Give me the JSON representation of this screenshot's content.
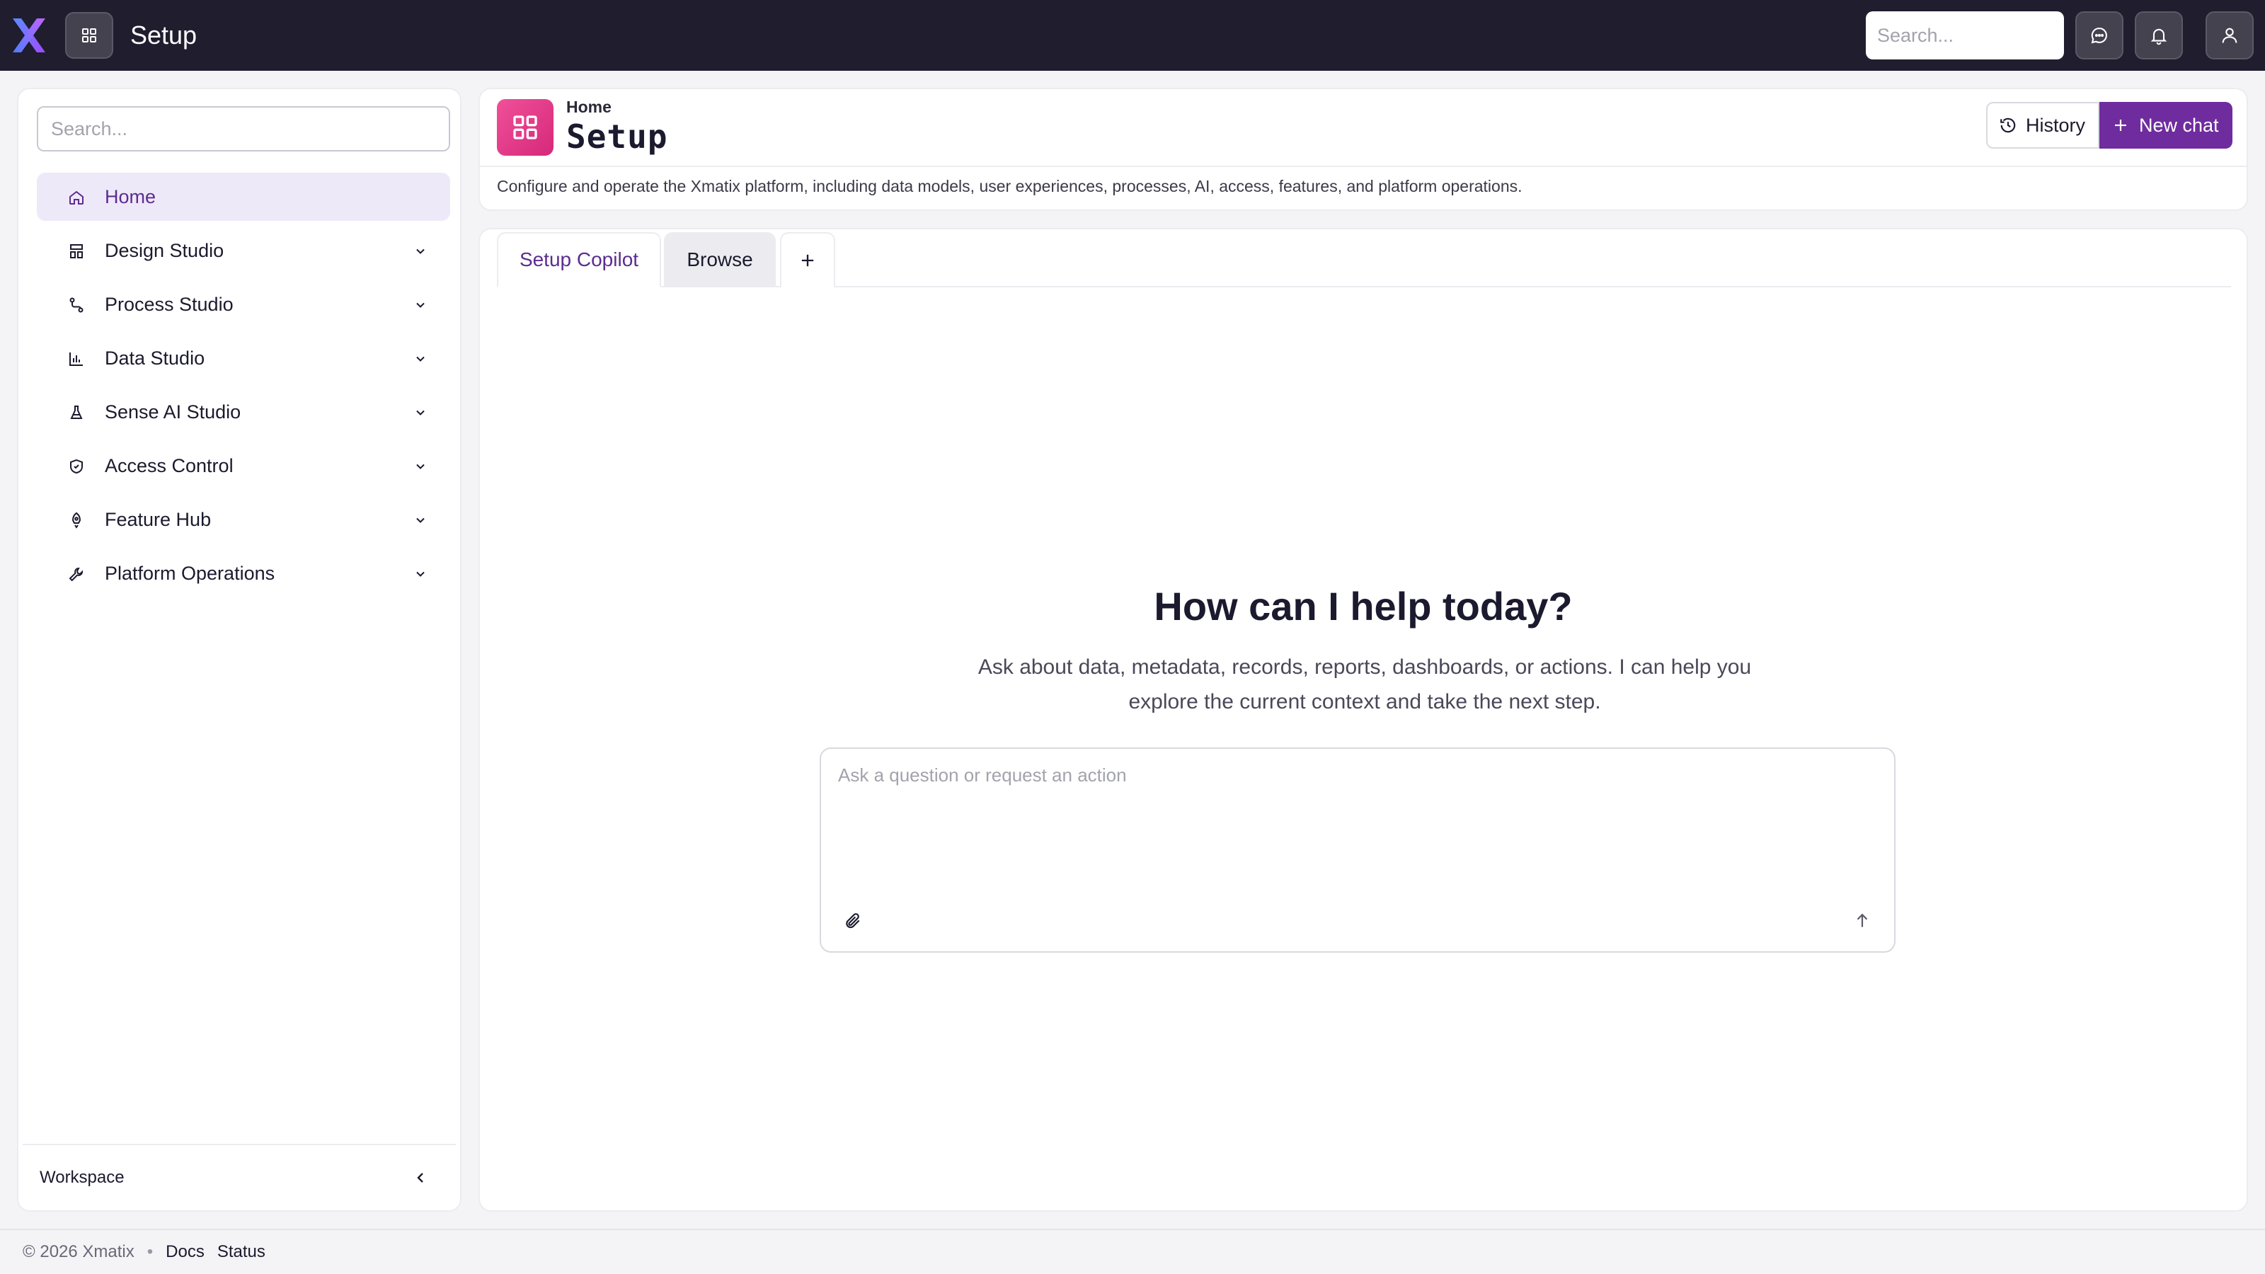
{
  "header": {
    "app_title": "Setup",
    "search_placeholder": "Search...",
    "icons": [
      "x-logo",
      "apps-grid-icon",
      "search-icon",
      "chat-bubble-icon",
      "bell-icon",
      "user-icon"
    ]
  },
  "sidebar": {
    "search_placeholder": "Search...",
    "items": [
      {
        "label": "Home",
        "icon": "home-icon",
        "active": true
      },
      {
        "label": "Design Studio",
        "icon": "design-icon"
      },
      {
        "label": "Process Studio",
        "icon": "process-icon"
      },
      {
        "label": "Data Studio",
        "icon": "bar-chart-icon"
      },
      {
        "label": "Sense AI Studio",
        "icon": "flask-icon"
      },
      {
        "label": "Access Control",
        "icon": "shield-icon"
      },
      {
        "label": "Feature Hub",
        "icon": "rocket-icon"
      },
      {
        "label": "Platform Operations",
        "icon": "wrench-icon"
      }
    ],
    "workspace_label": "Workspace"
  },
  "page": {
    "breadcrumb": "Home",
    "title": "Setup",
    "description": "Configure and operate the Xmatix platform, including data models, user experiences, processes, AI, access, features, and platform operations.",
    "history_label": "History",
    "new_chat_label": "New chat"
  },
  "tabs": [
    {
      "label": "Setup Copilot",
      "active": true
    },
    {
      "label": "Browse",
      "active": false
    }
  ],
  "copilot": {
    "title": "How can I help today?",
    "subtitle": "Ask about data, metadata, records, reports, dashboards, or actions. I can help you explore the current context and take the next step.",
    "input_placeholder": "Ask a question or request an action"
  },
  "footer": {
    "copyright": "© 2026 Xmatix",
    "docs": "Docs",
    "status": "Status"
  },
  "colors": {
    "topbar": "#1f1d2e",
    "accent": "#6f2c9e",
    "active_bg": "#eee9f8",
    "page_icon": "#e23d8c"
  }
}
